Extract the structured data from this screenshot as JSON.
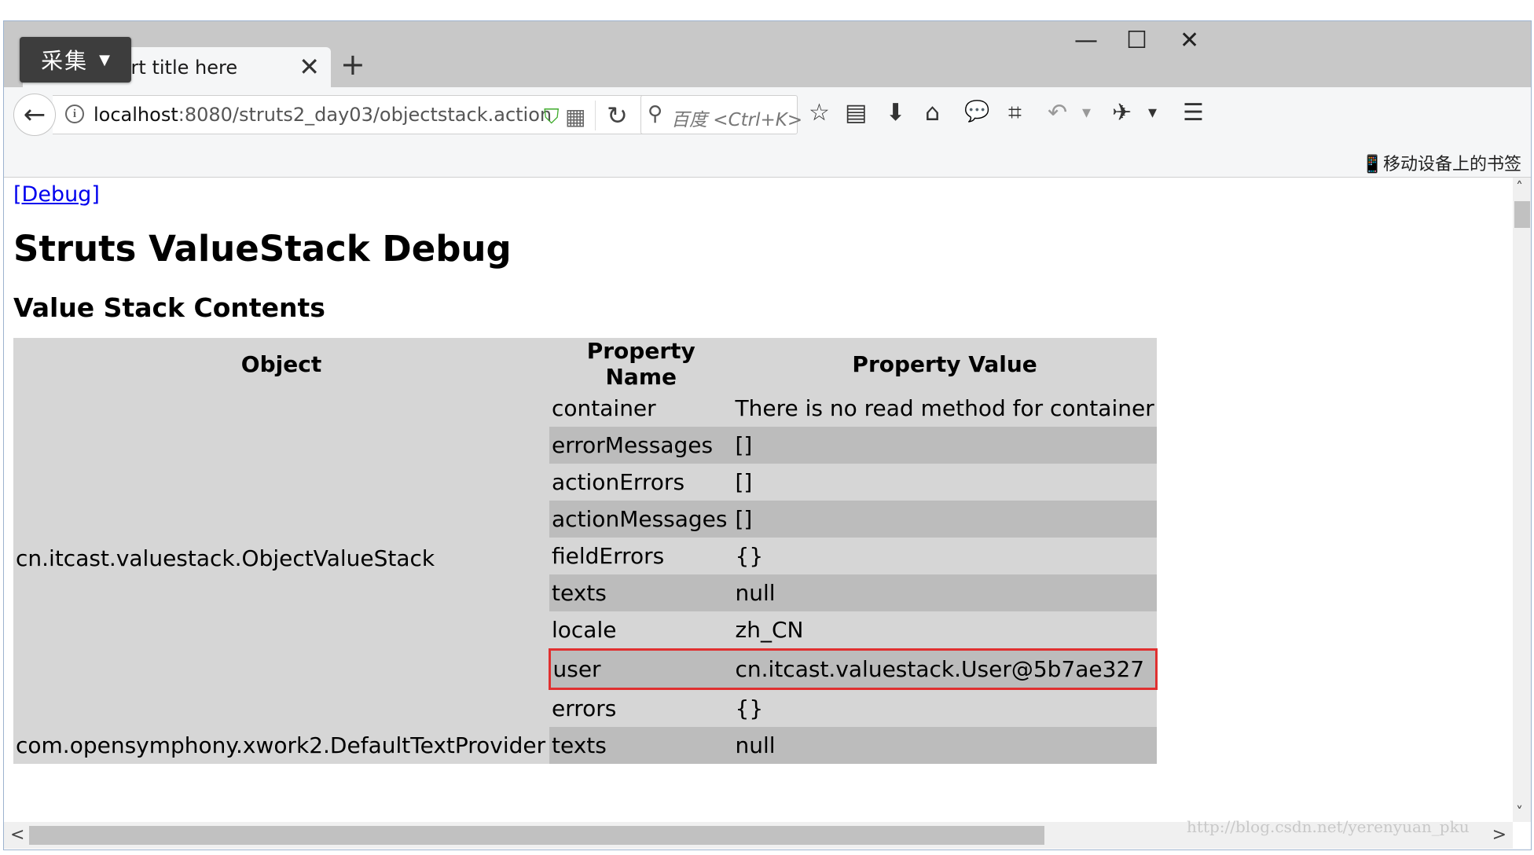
{
  "capture_button": {
    "label": "采集",
    "caret": "▼"
  },
  "tab": {
    "title": "Insert title here",
    "close": "✕"
  },
  "new_tab": "+",
  "window_controls": {
    "minimize": "—",
    "maximize": "☐",
    "close": "✕"
  },
  "nav": {
    "back": "←",
    "url_host": "localhost",
    "url_path": ":8080/struts2_day03/objectstack.action",
    "reload": "↻",
    "search_placeholder": "百度 <Ctrl+K>",
    "mobile_bookmarks": "📱移动设备上的书签"
  },
  "icons": {
    "star": "☆",
    "reading": "▤",
    "download": "⬇",
    "home": "⌂",
    "chat": "💬",
    "crop": "⌗",
    "undo": "↶",
    "dropdown": "▾",
    "bug": "✈",
    "menu": "☰",
    "info": "i",
    "shield": "⛉",
    "qr": "▦",
    "search": "⚲"
  },
  "page": {
    "debug_link": "[Debug]",
    "title": "Struts ValueStack Debug",
    "section": "Value Stack Contents",
    "table": {
      "headers": [
        "Object",
        "Property Name",
        "Property Value"
      ],
      "groups": [
        {
          "object": "cn.itcast.valuestack.ObjectValueStack",
          "rows": [
            {
              "name": "container",
              "value": "There is no read method for container"
            },
            {
              "name": "errorMessages",
              "value": "[]"
            },
            {
              "name": "actionErrors",
              "value": "[]"
            },
            {
              "name": "actionMessages",
              "value": "[]"
            },
            {
              "name": "fieldErrors",
              "value": "{}"
            },
            {
              "name": "texts",
              "value": "null"
            },
            {
              "name": "locale",
              "value": "zh_CN"
            },
            {
              "name": "user",
              "value": "cn.itcast.valuestack.User@5b7ae327",
              "highlighted": true
            },
            {
              "name": "errors",
              "value": "{}"
            }
          ]
        },
        {
          "object": "com.opensymphony.xwork2.DefaultTextProvider",
          "rows": [
            {
              "name": "texts",
              "value": "null"
            }
          ]
        }
      ]
    }
  },
  "scroll": {
    "up": "˄",
    "down": "˅",
    "left": "<",
    "right": ">"
  },
  "watermark": "http://blog.csdn.net/yerenyuan_pku",
  "colors": {
    "highlight": "#e03030",
    "link": "#0000ee",
    "row_light": "#d6d6d6",
    "row_dark": "#bcbcbc"
  }
}
